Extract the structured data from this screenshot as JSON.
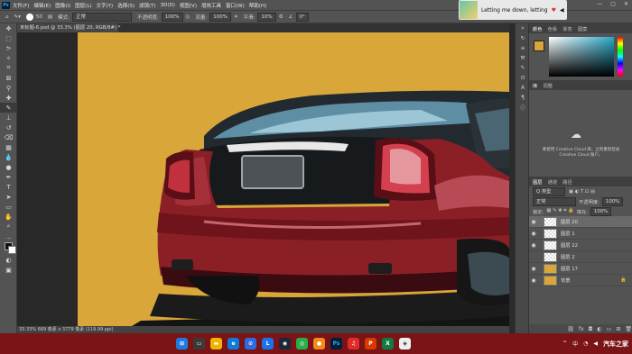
{
  "menubar": {
    "items": [
      "文件(F)",
      "编辑(E)",
      "图像(I)",
      "图层(L)",
      "文字(Y)",
      "选择(S)",
      "滤镜(T)",
      "3D(D)",
      "视图(V)",
      "增效工具",
      "窗口(W)",
      "帮助(H)"
    ]
  },
  "options": {
    "brush_size": "50",
    "mode_label": "模式:",
    "mode_value": "正常",
    "opacity_label": "不透明度:",
    "opacity_value": "100%",
    "flow_label": "流量:",
    "flow_value": "100%",
    "smooth_label": "平滑:",
    "smooth_value": "10%",
    "angle_value": "0°"
  },
  "notification": {
    "text": "Letting me down, letting"
  },
  "document": {
    "tab_title": "未标题-6.psd @ 33.3% (图层 20, RGB/8#) *",
    "status": "33.33%  669 像素 x 3779 像素 (119.99 ppi)"
  },
  "panels": {
    "color_tabs": [
      "颜色",
      "色板",
      "渐变",
      "图案"
    ],
    "library_tabs": [
      "库",
      "调整"
    ],
    "cc_text": "要使用 Creative Cloud 库，立刻重新登录 Creative Cloud 账户。",
    "layer_tabs": [
      "图层",
      "通道",
      "路径"
    ],
    "filter_label": "Q 类型",
    "blend_mode": "正常",
    "opacity_label": "不透明度:",
    "opacity_value": "100%",
    "lock_label": "锁定:",
    "fill_label": "填充:",
    "fill_value": "100%",
    "layers": [
      {
        "name": "图层 20"
      },
      {
        "name": "图层 1"
      },
      {
        "name": "图层 22"
      },
      {
        "name": "图层 2"
      },
      {
        "name": "图层 17"
      },
      {
        "name": "背景"
      }
    ]
  },
  "taskbar": {
    "time": "中",
    "watermark": "汽车之家"
  },
  "colors": {
    "canvas_bg": "#d9a63a",
    "car_body": "#8b1f26",
    "taskbar": "#7a1416"
  }
}
